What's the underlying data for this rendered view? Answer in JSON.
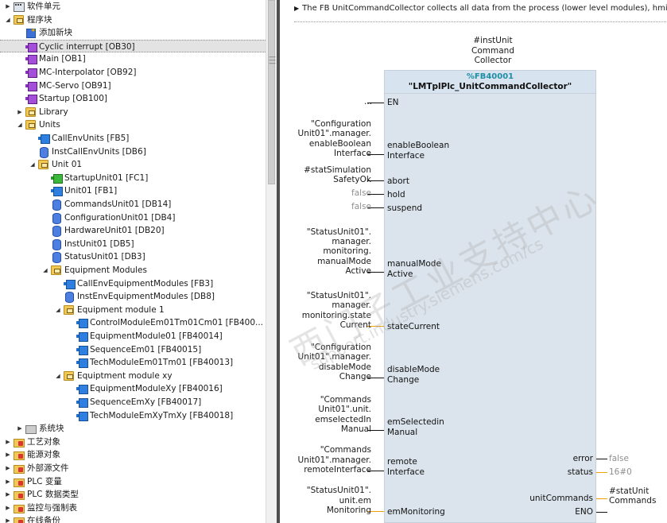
{
  "tree": {
    "items": [
      {
        "label": "软件单元",
        "icon": "software-unit-icon"
      },
      {
        "label": "程序块",
        "icon": "folder-icon"
      },
      {
        "label": "添加新块",
        "icon": "add-block-icon"
      },
      {
        "label": "Cyclic interrupt [OB30]",
        "icon": "ob-block-icon"
      },
      {
        "label": "Main [OB1]",
        "icon": "ob-block-icon"
      },
      {
        "label": "MC-Interpolator [OB92]",
        "icon": "ob-block-icon"
      },
      {
        "label": "MC-Servo [OB91]",
        "icon": "ob-block-icon"
      },
      {
        "label": "Startup [OB100]",
        "icon": "ob-block-icon"
      },
      {
        "label": "Library",
        "icon": "folder-icon"
      },
      {
        "label": "Units",
        "icon": "folder-icon"
      },
      {
        "label": "CallEnvUnits [FB5]",
        "icon": "fb-block-icon"
      },
      {
        "label": "InstCallEnvUnits [DB6]",
        "icon": "db-block-icon"
      },
      {
        "label": "Unit 01",
        "icon": "folder-icon"
      },
      {
        "label": "StartupUnit01 [FC1]",
        "icon": "fc-block-icon"
      },
      {
        "label": "Unit01 [FB1]",
        "icon": "fb-block-icon"
      },
      {
        "label": "CommandsUnit01 [DB14]",
        "icon": "db-block-icon"
      },
      {
        "label": "ConfigurationUnit01 [DB4]",
        "icon": "db-block-icon"
      },
      {
        "label": "HardwareUnit01 [DB20]",
        "icon": "db-block-icon"
      },
      {
        "label": "InstUnit01 [DB5]",
        "icon": "db-block-icon"
      },
      {
        "label": "StatusUnit01 [DB3]",
        "icon": "db-block-icon"
      },
      {
        "label": "Equipment Modules",
        "icon": "folder-icon"
      },
      {
        "label": "CallEnvEquipmentModules [FB3]",
        "icon": "fb-block-icon"
      },
      {
        "label": "InstEnvEquipmentModules [DB8]",
        "icon": "db-block-icon"
      },
      {
        "label": "Equipment module 1",
        "icon": "folder-icon"
      },
      {
        "label": "ControlModuleEm01Tm01Cm01 [FB400...",
        "icon": "fb-block-icon"
      },
      {
        "label": "EquipmentModule01 [FB40014]",
        "icon": "fb-block-icon"
      },
      {
        "label": "SequenceEm01 [FB40015]",
        "icon": "fb-block-icon"
      },
      {
        "label": "TechModuleEm01Tm01 [FB40013]",
        "icon": "fb-block-icon"
      },
      {
        "label": "Equiptment module xy",
        "icon": "folder-icon"
      },
      {
        "label": "EquipmentModuleXy [FB40016]",
        "icon": "fb-block-icon"
      },
      {
        "label": "SequenceEmXy [FB40017]",
        "icon": "fb-block-icon"
      },
      {
        "label": "TechModuleEmXyTmXy [FB40018]",
        "icon": "fb-block-icon"
      },
      {
        "label": "系统块",
        "icon": "system-block-icon"
      },
      {
        "label": "工艺对象",
        "icon": "technology-object-icon"
      },
      {
        "label": "能源对象",
        "icon": "energy-object-icon"
      },
      {
        "label": "外部源文件",
        "icon": "external-source-icon"
      },
      {
        "label": "PLC 变量",
        "icon": "plc-tags-icon"
      },
      {
        "label": "PLC 数据类型",
        "icon": "plc-datatype-icon"
      },
      {
        "label": "监控与强制表",
        "icon": "watch-table-icon"
      },
      {
        "label": "在线备份",
        "icon": "online-backup-icon"
      }
    ]
  },
  "network": {
    "comment": "The FB UnitCommandCollector collects all data from the process (lower level modules), hmi exte",
    "instance_lines": [
      "#instUnit",
      "Command",
      "Collector"
    ],
    "block_number": "%FB40001",
    "block_name": "\"LMTplPlc_UnitCommandCollector\"",
    "en_input": "...",
    "pins_in": {
      "en": "EN",
      "enable_boolean_interface": [
        "enableBoolean",
        "Interface"
      ],
      "abort": "abort",
      "hold": "hold",
      "suspend": "suspend",
      "manual_mode_active": [
        "manualMode",
        "Active"
      ],
      "state_current": "stateCurrent",
      "disable_mode_change": [
        "disableMode",
        "Change"
      ],
      "em_selected_in_manual": [
        "emSelectedin",
        "Manual"
      ],
      "remote_interface": [
        "remote",
        "Interface"
      ],
      "em_monitoring": "emMonitoring"
    },
    "params_in": {
      "enable_boolean_interface": [
        "\"Configuration",
        "Unit01\".manager.",
        "enableBoolean",
        "Interface"
      ],
      "abort": [
        "#statSimulation",
        "SafetyOk"
      ],
      "hold": "false",
      "suspend": "false",
      "manual_mode_active": [
        "\"StatusUnit01\".",
        "manager.",
        "monitoring.",
        "manualMode",
        "Active"
      ],
      "state_current": [
        "\"StatusUnit01\".",
        "manager.",
        "monitoring.state",
        "Current"
      ],
      "disable_mode_change": [
        "\"Configuration",
        "Unit01\".manager.",
        "disableMode",
        "Change"
      ],
      "em_selected_in_manual": [
        "\"Commands",
        "Unit01\".unit.",
        "emselectedIn",
        "Manual"
      ],
      "remote_interface": [
        "\"Commands",
        "Unit01\".manager.",
        "remoteInterface"
      ],
      "em_monitoring": [
        "\"StatusUnit01\".",
        "unit.em",
        "Monitoring"
      ]
    },
    "pins_out": {
      "error": "error",
      "status": "status",
      "unit_commands": "unitCommands",
      "eno": "ENO"
    },
    "params_out": {
      "error": "false",
      "status": "16#0",
      "unit_commands": [
        "#statUnit",
        "Commands"
      ]
    }
  },
  "watermark": {
    "text_cn": "西门子工业支持中心",
    "text_url": "support.industry.siemens.com/cs"
  },
  "colors": {
    "block_fill": "#dbe4ec",
    "block_number": "#1f8ea6",
    "wire_bool": "#111111",
    "wire_data": "#f0a000",
    "ob_icon": "#a44fd8",
    "fb_icon": "#2f7fe0",
    "fc_icon": "#3cb83c",
    "db_icon": "#4d7fe0"
  }
}
